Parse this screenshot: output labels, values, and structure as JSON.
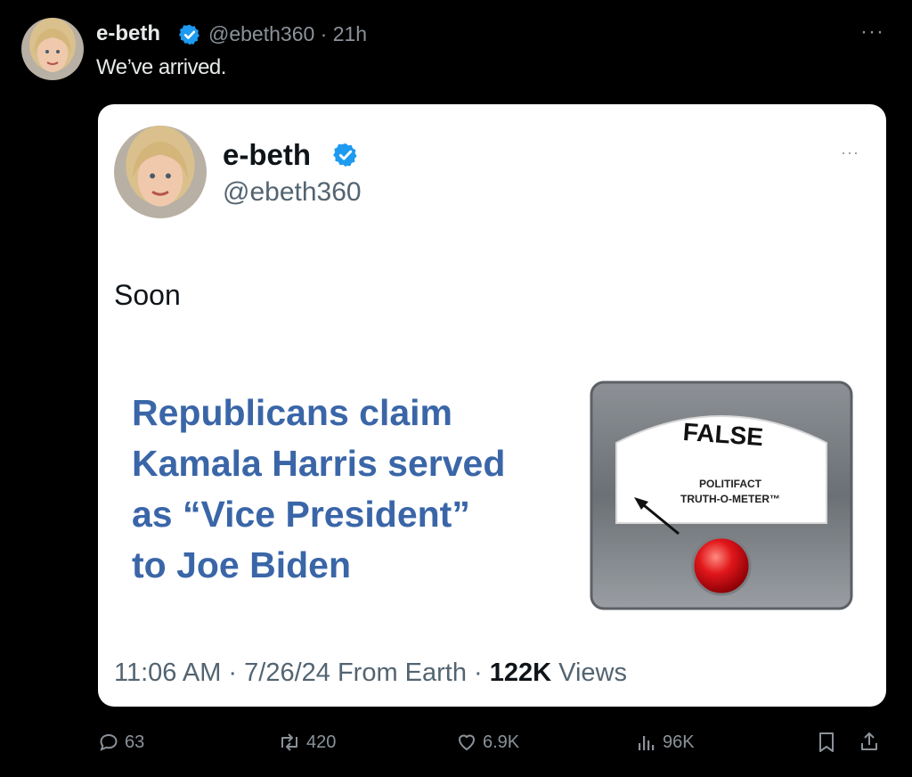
{
  "tweet": {
    "author_name": "e-beth",
    "author_handle": "@ebeth360",
    "time_ago": "21h",
    "handle_time": "@ebeth360 · 21h",
    "text": "We’ve arrived.",
    "more_icon": "ellipsis-icon"
  },
  "quoted_tweet": {
    "author_name": "e-beth",
    "author_handle": "@ebeth360",
    "text": "Soon",
    "image": {
      "headline_lines": [
        "Republicans claim",
        "Kamala Harris served",
        "as “Vice President”",
        "to Joe Biden"
      ],
      "meter_label": "FALSE",
      "meter_brand_line1": "POLITIFACT",
      "meter_brand_line2": "TRUTH-O-METER™"
    },
    "timestamp": "11:06 AM · 7/26/24 From Earth · ",
    "views_count": "122K",
    "views_label": " Views"
  },
  "actions": {
    "replies": "63",
    "reposts": "420",
    "likes": "6.9K",
    "views": "96K"
  },
  "colors": {
    "background": "#000000",
    "card": "#ffffff",
    "verified": "#1d9bf0",
    "headline": "#3a66a8",
    "meter_button": "#e0161a"
  }
}
